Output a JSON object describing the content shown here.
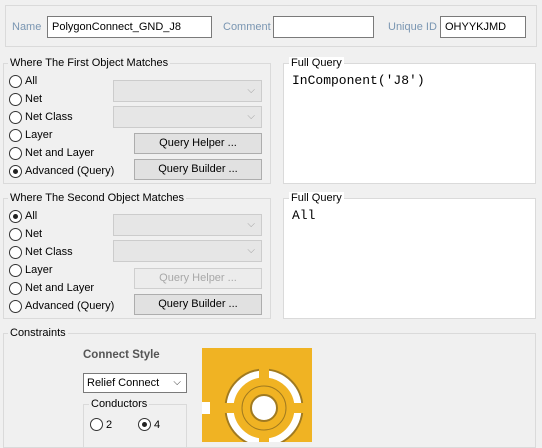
{
  "header": {
    "name_label": "Name",
    "name_value": "PolygonConnect_GND_J8",
    "comment_label": "Comment",
    "comment_value": "",
    "unique_id_label": "Unique ID",
    "unique_id_value": "OHYYKJMD"
  },
  "first_match": {
    "title": "Where The First Object Matches",
    "options": [
      "All",
      "Net",
      "Net Class",
      "Layer",
      "Net and Layer",
      "Advanced (Query)"
    ],
    "selected": "Advanced (Query)",
    "query_helper_label": "Query Helper ...",
    "query_builder_label": "Query Builder ..."
  },
  "first_query": {
    "title": "Full Query",
    "text": "InComponent('J8')"
  },
  "second_match": {
    "title": "Where The Second Object Matches",
    "options": [
      "All",
      "Net",
      "Net Class",
      "Layer",
      "Net and Layer",
      "Advanced (Query)"
    ],
    "selected": "All",
    "query_helper_label": "Query Helper ...",
    "query_builder_label": "Query Builder ..."
  },
  "second_query": {
    "title": "Full Query",
    "text": "All"
  },
  "constraints": {
    "title": "Constraints",
    "connect_style_label": "Connect Style",
    "connect_style_value": "Relief Connect",
    "conductors_label": "Conductors",
    "conductor_options": [
      "2",
      "4"
    ],
    "conductor_selected": "4"
  },
  "colors": {
    "preview_gold": "#f0b323",
    "preview_dark": "#a07a20",
    "preview_light": "#ffffff"
  }
}
